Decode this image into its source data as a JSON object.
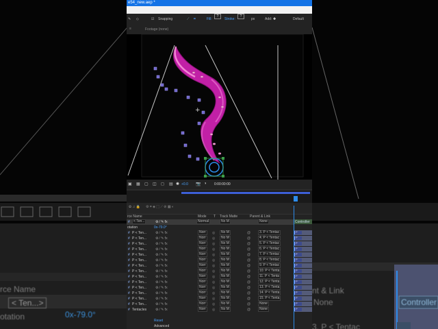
{
  "window": {
    "title": "e54_new.aep *"
  },
  "toolbar": {
    "snapping_label": "Snapping",
    "fill_label": "Fill:",
    "fill_value": "?",
    "stroke_label": "Stroke:",
    "stroke_value": "?",
    "stroke_unit": "px",
    "add_label": "Add:",
    "default_label": "Default"
  },
  "panels": {
    "footage_tab": "Footage (none)"
  },
  "viewer": {
    "zoom_value": "+0.0",
    "timecode": "0:00:00:00",
    "accent": "#d024b5"
  },
  "timeline": {
    "columns": {
      "layer_name": "rce Name",
      "mode": "Mode",
      "t": "T",
      "track_matte": "Track Matte",
      "parent_link": "Parent & Link"
    },
    "selected_row": {
      "name": "< Ten...",
      "mode": "Normal",
      "track_matte": "No M",
      "parent": "None"
    },
    "rotation": {
      "label": "otation",
      "value": "0x-79.0°"
    },
    "rows": [
      {
        "name": "P < Ten...",
        "mode": "Norr",
        "matte": "No M",
        "parent": "3. P < Tentac"
      },
      {
        "name": "P < Ten...",
        "mode": "Norr",
        "matte": "No M",
        "parent": "4. P < Tentac"
      },
      {
        "name": "P < Ten...",
        "mode": "Norr",
        "matte": "No M",
        "parent": "5. P < Tentac"
      },
      {
        "name": "P < Ten...",
        "mode": "Norr",
        "matte": "No M",
        "parent": "6. P < Tentac"
      },
      {
        "name": "P < Ten...",
        "mode": "Norr",
        "matte": "No M",
        "parent": "7. P < Tentac"
      },
      {
        "name": "P < Ten...",
        "mode": "Norr",
        "matte": "No M",
        "parent": "8. P < Tentac"
      },
      {
        "name": "P < Ten...",
        "mode": "Norr",
        "matte": "No M",
        "parent": "9. P < Tentac"
      },
      {
        "name": "P < Ten...",
        "mode": "Norr",
        "matte": "No M",
        "parent": "10. P < Tenta"
      },
      {
        "name": "P < Ten...",
        "mode": "Norr",
        "matte": "No M",
        "parent": "11. P < Tenta"
      },
      {
        "name": "P < Ten...",
        "mode": "Norr",
        "matte": "No M",
        "parent": "12. P < Tenta"
      },
      {
        "name": "P < Ten...",
        "mode": "Norr",
        "matte": "No M",
        "parent": "13. P < Tenta"
      },
      {
        "name": "P < Ten...",
        "mode": "Norr",
        "matte": "No M",
        "parent": "14. P < Tenta"
      },
      {
        "name": "P < Ten...",
        "mode": "Norr",
        "matte": "No M",
        "parent": "15. P < Tenta"
      },
      {
        "name": "P < Ten...",
        "mode": "Norr",
        "matte": "No M",
        "parent": "None"
      },
      {
        "name": "Tentacles",
        "mode": "Norr",
        "matte": "No M",
        "parent": "None"
      }
    ],
    "reset_label": "Reset",
    "advanced_label": "Advanced",
    "controller_label": "Controller",
    "bar_label": "P"
  },
  "background": {
    "left_layer_name": "rce Name",
    "left_selected": "< Ten...>",
    "left_rotation": "otation",
    "left_rotation_value": "0x-79.0°",
    "right_parent": "nt & Link",
    "right_none": "None",
    "right_controller": "Controller",
    "right_tentac": "3. P < Tentac"
  }
}
